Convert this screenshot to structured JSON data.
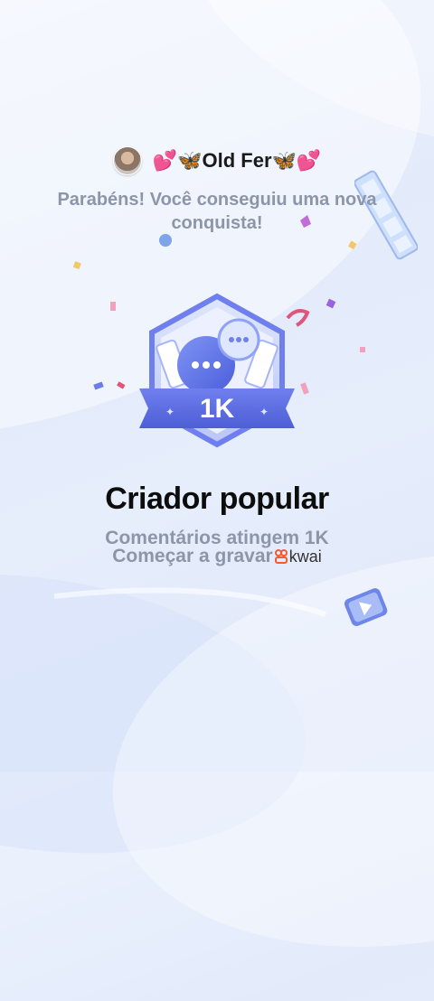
{
  "header": {
    "username": "💕🦋Old Fer🦋💕",
    "congrats_text": "Parabéns! Você conseguiu uma nova conquista!"
  },
  "badge": {
    "value_label": "1K",
    "icon": "chat-bubbles-icon"
  },
  "achievement": {
    "title": "Criador popular",
    "description": "Comentários atingem 1K",
    "cta": "Começar a gravar",
    "brand": "kwai"
  },
  "colors": {
    "badge_primary": "#5b6ee8",
    "badge_light": "#c9d3fb",
    "text_muted": "#8d95a8",
    "title": "#0d0d0d"
  }
}
